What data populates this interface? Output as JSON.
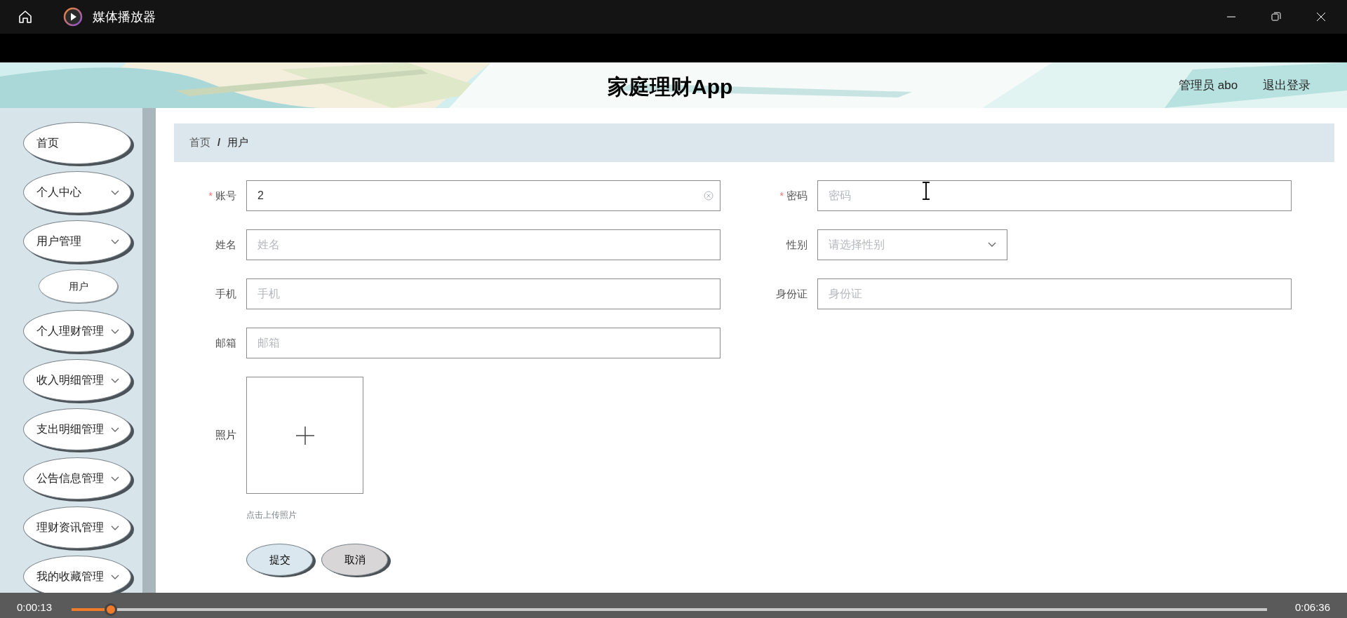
{
  "window": {
    "title": "媒体播放器"
  },
  "header": {
    "title": "家庭理财App",
    "user": "管理员 abo",
    "logout": "退出登录"
  },
  "sidebar": {
    "items": [
      {
        "label": "首页",
        "kind": "link"
      },
      {
        "label": "个人中心",
        "kind": "group"
      },
      {
        "label": "用户管理",
        "kind": "group",
        "expanded": true,
        "children": [
          {
            "label": "用户"
          }
        ]
      },
      {
        "label": "个人理财管理",
        "kind": "group"
      },
      {
        "label": "收入明细管理",
        "kind": "group"
      },
      {
        "label": "支出明细管理",
        "kind": "group"
      },
      {
        "label": "公告信息管理",
        "kind": "group"
      },
      {
        "label": "理财资讯管理",
        "kind": "group"
      },
      {
        "label": "我的收藏管理",
        "kind": "group"
      }
    ]
  },
  "breadcrumb": {
    "items": [
      "首页",
      "用户"
    ],
    "separator": "/"
  },
  "form": {
    "required_mark": "*",
    "fields": [
      {
        "label": "账号",
        "required": true,
        "kind": "text",
        "value": "2",
        "clearable": true
      },
      {
        "label": "密码",
        "required": true,
        "kind": "text",
        "placeholder": "密码"
      },
      {
        "label": "姓名",
        "kind": "text",
        "placeholder": "姓名"
      },
      {
        "label": "性别",
        "kind": "select",
        "placeholder": "请选择性别"
      },
      {
        "label": "手机",
        "kind": "text",
        "placeholder": "手机"
      },
      {
        "label": "身份证",
        "kind": "text",
        "placeholder": "身份证"
      },
      {
        "label": "邮箱",
        "kind": "text",
        "placeholder": "邮箱"
      }
    ],
    "photo": {
      "label": "照片",
      "hint": "点击上传照片"
    },
    "buttons": [
      {
        "label": "提交",
        "kind": "primary"
      },
      {
        "label": "取消",
        "kind": "secondary"
      }
    ]
  },
  "player": {
    "elapsed": "0:00:13",
    "duration": "0:06:36",
    "level": 0.033
  }
}
